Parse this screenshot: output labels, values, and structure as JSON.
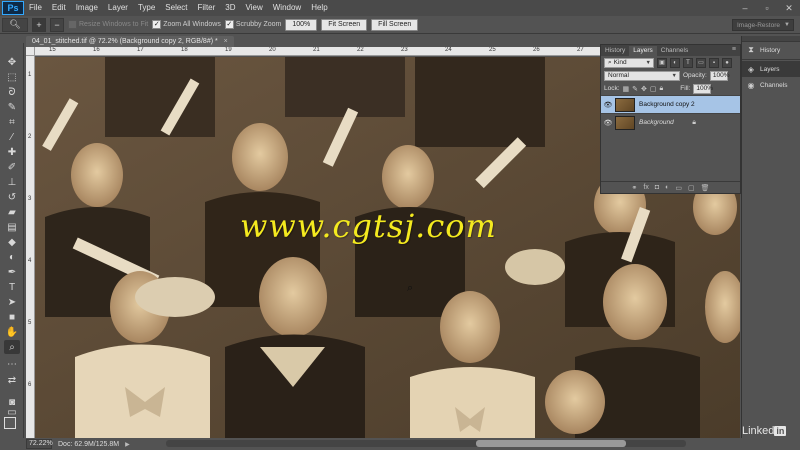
{
  "app": {
    "logo": "Ps"
  },
  "menu": [
    "File",
    "Edit",
    "Image",
    "Layer",
    "Type",
    "Select",
    "Filter",
    "3D",
    "View",
    "Window",
    "Help"
  ],
  "window_controls": [
    "–",
    "▫",
    "✕"
  ],
  "options_bar": {
    "resize_windows": {
      "label": "Resize Windows to Fit",
      "checked": false,
      "disabled": true
    },
    "zoom_all_windows": {
      "label": "Zoom All Windows",
      "checked": true
    },
    "scrubby_zoom": {
      "label": "Scrubby Zoom",
      "checked": true
    },
    "btn_100": "100%",
    "btn_fit": "Fit Screen",
    "btn_fill": "Fill Screen",
    "workspace": "Image-Restore"
  },
  "document": {
    "tab_title": "04_01_stitched.tif @ 72.2% (Background copy 2, RGB/8#) *",
    "close": "×"
  },
  "rulers": {
    "h_labels": [
      "15",
      "16",
      "17",
      "18",
      "19",
      "20",
      "21",
      "22",
      "23",
      "24",
      "25",
      "26",
      "27"
    ],
    "v_labels": [
      "1",
      "2",
      "3",
      "4",
      "5",
      "6"
    ]
  },
  "watermark": "www.cgtsj.com",
  "status": {
    "zoom": "72.22%",
    "doc": "Doc: 62.9M/125.8M"
  },
  "layers_panel": {
    "tabs": [
      "History",
      "Layers",
      "Channels"
    ],
    "active_tab": "Layers",
    "kind": "Kind",
    "blend_mode": "Normal",
    "opacity_label": "Opacity:",
    "opacity_value": "100%",
    "lock_label": "Lock:",
    "fill_label": "Fill:",
    "fill_value": "100%",
    "layers": [
      {
        "name": "Background copy 2",
        "selected": true
      },
      {
        "name": "Background",
        "selected": false,
        "locked": true
      }
    ]
  },
  "dock": {
    "items": [
      {
        "label": "History",
        "icon": "history-icon"
      },
      {
        "label": "Layers",
        "icon": "layers-icon",
        "active": true
      },
      {
        "label": "Channels",
        "icon": "channels-icon"
      }
    ]
  },
  "brand": {
    "name": "Linked",
    "badge": "in"
  }
}
